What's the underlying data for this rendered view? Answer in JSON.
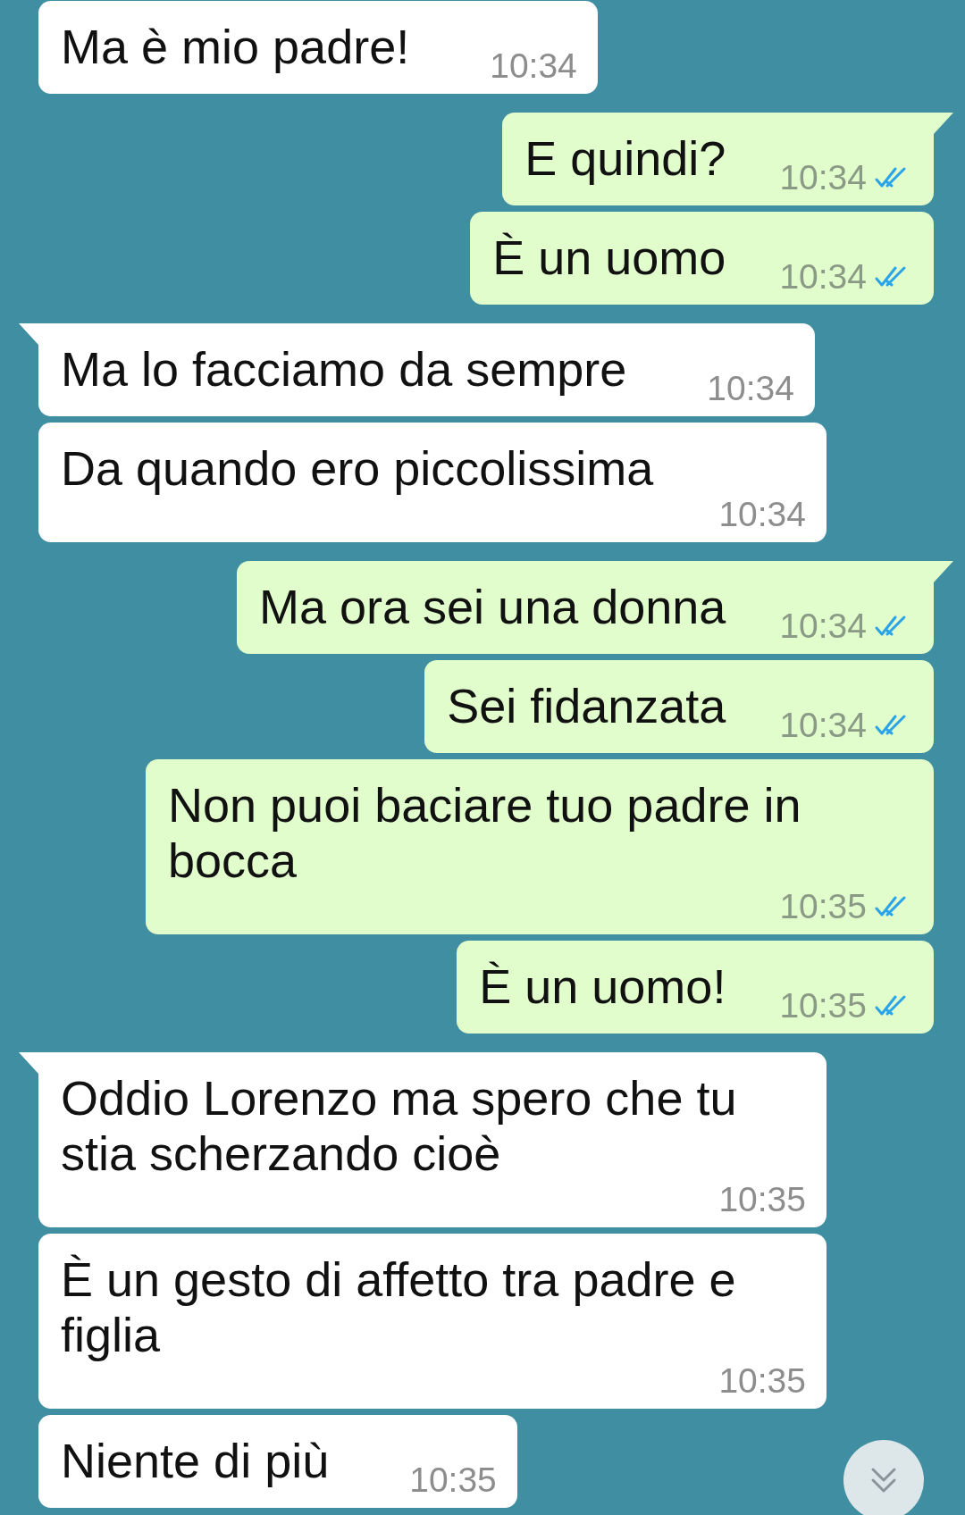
{
  "messages": [
    {
      "kind": "in",
      "tail": false,
      "text": "Ma è mio padre!",
      "time": "10:34",
      "read": false
    },
    {
      "kind": "out",
      "tail": true,
      "text": "E quindi?",
      "time": "10:34",
      "read": true
    },
    {
      "kind": "out",
      "tail": false,
      "text": "È un uomo",
      "time": "10:34",
      "read": true
    },
    {
      "kind": "in",
      "tail": true,
      "text": "Ma lo facciamo da sempre",
      "time": "10:34",
      "read": false
    },
    {
      "kind": "in",
      "tail": false,
      "text": "Da quando ero piccolissima",
      "time": "10:34",
      "read": false
    },
    {
      "kind": "out",
      "tail": true,
      "text": "Ma ora sei una donna",
      "time": "10:34",
      "read": true
    },
    {
      "kind": "out",
      "tail": false,
      "text": "Sei fidanzata",
      "time": "10:34",
      "read": true
    },
    {
      "kind": "out",
      "tail": false,
      "text": "Non puoi baciare tuo padre in bocca",
      "time": "10:35",
      "read": true
    },
    {
      "kind": "out",
      "tail": false,
      "text": "È un uomo!",
      "time": "10:35",
      "read": true
    },
    {
      "kind": "in",
      "tail": true,
      "text": "Oddio Lorenzo ma spero che tu stia scherzando cioè",
      "time": "10:35",
      "read": false
    },
    {
      "kind": "in",
      "tail": false,
      "text": "È un gesto di affetto tra padre e figlia",
      "time": "10:35",
      "read": false
    },
    {
      "kind": "in",
      "tail": false,
      "text": "Niente di più",
      "time": "10:35",
      "read": false
    }
  ]
}
